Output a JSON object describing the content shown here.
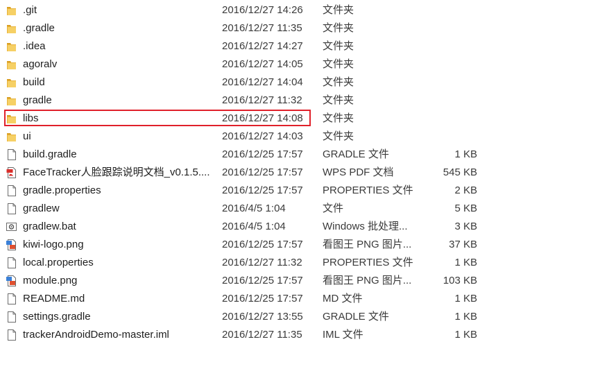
{
  "files": [
    {
      "name": ".git",
      "date": "2016/12/27 14:26",
      "type": "文件夹",
      "size": "",
      "icon": "folder-icon"
    },
    {
      "name": ".gradle",
      "date": "2016/12/27 11:35",
      "type": "文件夹",
      "size": "",
      "icon": "folder-icon"
    },
    {
      "name": ".idea",
      "date": "2016/12/27 14:27",
      "type": "文件夹",
      "size": "",
      "icon": "folder-icon"
    },
    {
      "name": "agoralv",
      "date": "2016/12/27 14:05",
      "type": "文件夹",
      "size": "",
      "icon": "folder-icon"
    },
    {
      "name": "build",
      "date": "2016/12/27 14:04",
      "type": "文件夹",
      "size": "",
      "icon": "folder-icon"
    },
    {
      "name": "gradle",
      "date": "2016/12/27 11:32",
      "type": "文件夹",
      "size": "",
      "icon": "folder-icon"
    },
    {
      "name": "libs",
      "date": "2016/12/27 14:08",
      "type": "文件夹",
      "size": "",
      "icon": "folder-icon",
      "highlighted": true
    },
    {
      "name": "ui",
      "date": "2016/12/27 14:03",
      "type": "文件夹",
      "size": "",
      "icon": "folder-icon"
    },
    {
      "name": "build.gradle",
      "date": "2016/12/25 17:57",
      "type": "GRADLE 文件",
      "size": "1 KB",
      "icon": "file-icon"
    },
    {
      "name": "FaceTracker人脸跟踪说明文档_v0.1.5....",
      "date": "2016/12/25 17:57",
      "type": "WPS PDF 文档",
      "size": "545 KB",
      "icon": "pdf-icon"
    },
    {
      "name": "gradle.properties",
      "date": "2016/12/25 17:57",
      "type": "PROPERTIES 文件",
      "size": "2 KB",
      "icon": "file-icon"
    },
    {
      "name": "gradlew",
      "date": "2016/4/5 1:04",
      "type": "文件",
      "size": "5 KB",
      "icon": "file-icon"
    },
    {
      "name": "gradlew.bat",
      "date": "2016/4/5 1:04",
      "type": "Windows 批处理...",
      "size": "3 KB",
      "icon": "bat-icon"
    },
    {
      "name": "kiwi-logo.png",
      "date": "2016/12/25 17:57",
      "type": "看图王 PNG 图片...",
      "size": "37 KB",
      "icon": "image-icon"
    },
    {
      "name": "local.properties",
      "date": "2016/12/27 11:32",
      "type": "PROPERTIES 文件",
      "size": "1 KB",
      "icon": "file-icon"
    },
    {
      "name": "module.png",
      "date": "2016/12/25 17:57",
      "type": "看图王 PNG 图片...",
      "size": "103 KB",
      "icon": "image-icon"
    },
    {
      "name": "README.md",
      "date": "2016/12/25 17:57",
      "type": "MD 文件",
      "size": "1 KB",
      "icon": "file-icon"
    },
    {
      "name": "settings.gradle",
      "date": "2016/12/27 13:55",
      "type": "GRADLE 文件",
      "size": "1 KB",
      "icon": "file-icon"
    },
    {
      "name": "trackerAndroidDemo-master.iml",
      "date": "2016/12/27 11:35",
      "type": "IML 文件",
      "size": "1 KB",
      "icon": "file-icon"
    }
  ],
  "colors": {
    "folder": "#f0c040",
    "highlight_border": "#e0202a",
    "pdf": "#d9302c",
    "image": "#3a80d8"
  }
}
